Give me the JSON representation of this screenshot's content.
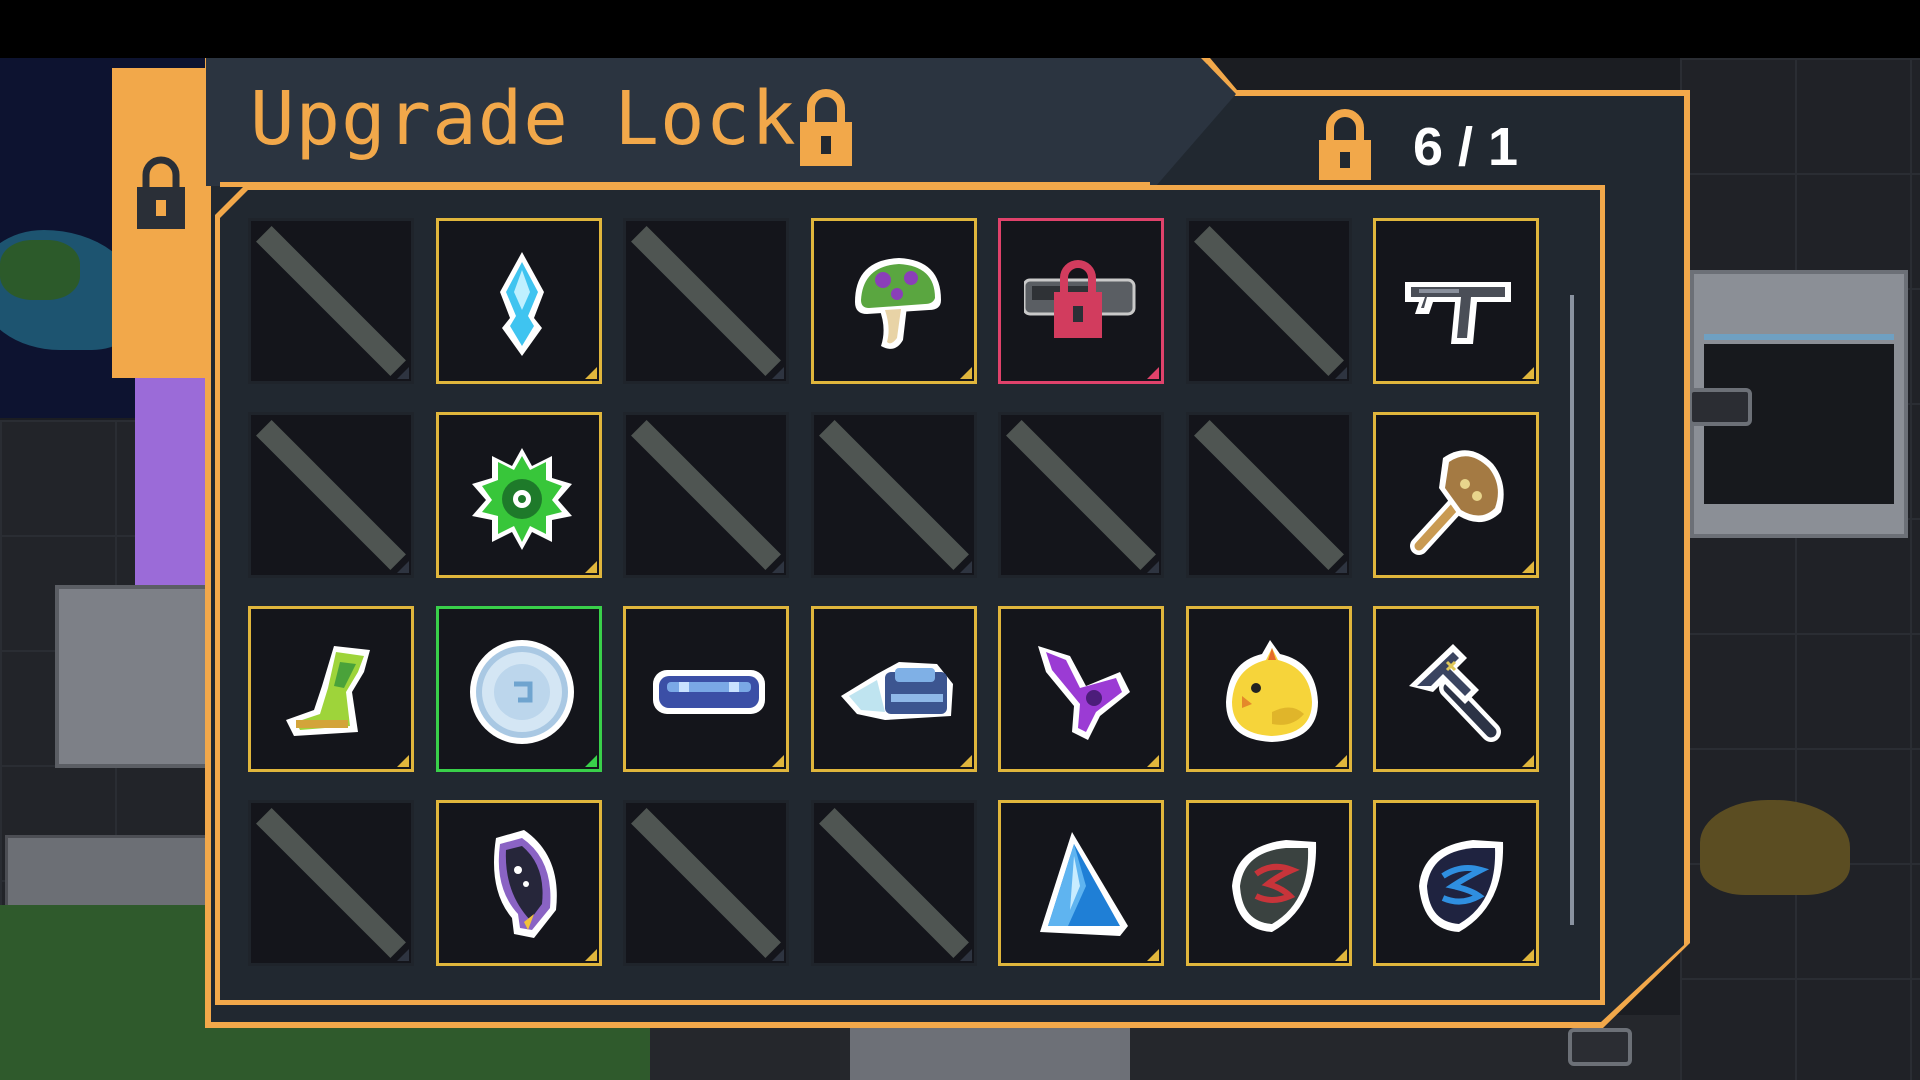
{
  "panel": {
    "title": "Upgrade Lock",
    "lock_count": "6 / 1"
  },
  "colors": {
    "accent": "#f2a84a",
    "panel_bg": "#212830",
    "rarity_gold": "#e0b63c",
    "rarity_green": "#39d04a",
    "rarity_red": "#e0426b"
  },
  "slots": [
    {
      "row": 1,
      "col": 1,
      "state": "empty"
    },
    {
      "row": 1,
      "col": 2,
      "state": "item",
      "border": "gold",
      "icon": "blue-crystal-icon"
    },
    {
      "row": 1,
      "col": 3,
      "state": "empty"
    },
    {
      "row": 1,
      "col": 4,
      "state": "item",
      "border": "gold",
      "icon": "green-mushroom-icon"
    },
    {
      "row": 1,
      "col": 5,
      "state": "locked",
      "border": "red",
      "icon": "locked-gun-icon"
    },
    {
      "row": 1,
      "col": 6,
      "state": "empty"
    },
    {
      "row": 1,
      "col": 7,
      "state": "item",
      "border": "gold",
      "icon": "uzi-gun-icon"
    },
    {
      "row": 2,
      "col": 1,
      "state": "empty"
    },
    {
      "row": 2,
      "col": 2,
      "state": "item",
      "border": "gold",
      "icon": "green-gear-icon"
    },
    {
      "row": 2,
      "col": 3,
      "state": "empty"
    },
    {
      "row": 2,
      "col": 4,
      "state": "empty"
    },
    {
      "row": 2,
      "col": 5,
      "state": "empty"
    },
    {
      "row": 2,
      "col": 6,
      "state": "empty"
    },
    {
      "row": 2,
      "col": 7,
      "state": "item",
      "border": "gold",
      "icon": "battle-axe-icon"
    },
    {
      "row": 3,
      "col": 1,
      "state": "item",
      "border": "gold",
      "icon": "green-boot-icon"
    },
    {
      "row": 3,
      "col": 2,
      "state": "item",
      "border": "green",
      "icon": "ice-disc-icon"
    },
    {
      "row": 3,
      "col": 3,
      "state": "item",
      "border": "gold",
      "icon": "blue-capsule-icon"
    },
    {
      "row": 3,
      "col": 4,
      "state": "item",
      "border": "gold",
      "icon": "ice-tank-icon"
    },
    {
      "row": 3,
      "col": 5,
      "state": "item",
      "border": "gold",
      "icon": "purple-slingshot-icon"
    },
    {
      "row": 3,
      "col": 6,
      "state": "item",
      "border": "gold",
      "icon": "yellow-chick-icon"
    },
    {
      "row": 3,
      "col": 7,
      "state": "item",
      "border": "gold",
      "icon": "dark-hammer-icon"
    },
    {
      "row": 4,
      "col": 1,
      "state": "empty"
    },
    {
      "row": 4,
      "col": 2,
      "state": "item",
      "border": "gold",
      "icon": "dark-feather-icon"
    },
    {
      "row": 4,
      "col": 3,
      "state": "empty"
    },
    {
      "row": 4,
      "col": 4,
      "state": "empty"
    },
    {
      "row": 4,
      "col": 5,
      "state": "item",
      "border": "gold",
      "icon": "ice-shard-icon"
    },
    {
      "row": 4,
      "col": 6,
      "state": "item",
      "border": "gold",
      "icon": "red-rune-stone-icon"
    },
    {
      "row": 4,
      "col": 7,
      "state": "item",
      "border": "gold",
      "icon": "blue-rune-stone-icon"
    }
  ]
}
